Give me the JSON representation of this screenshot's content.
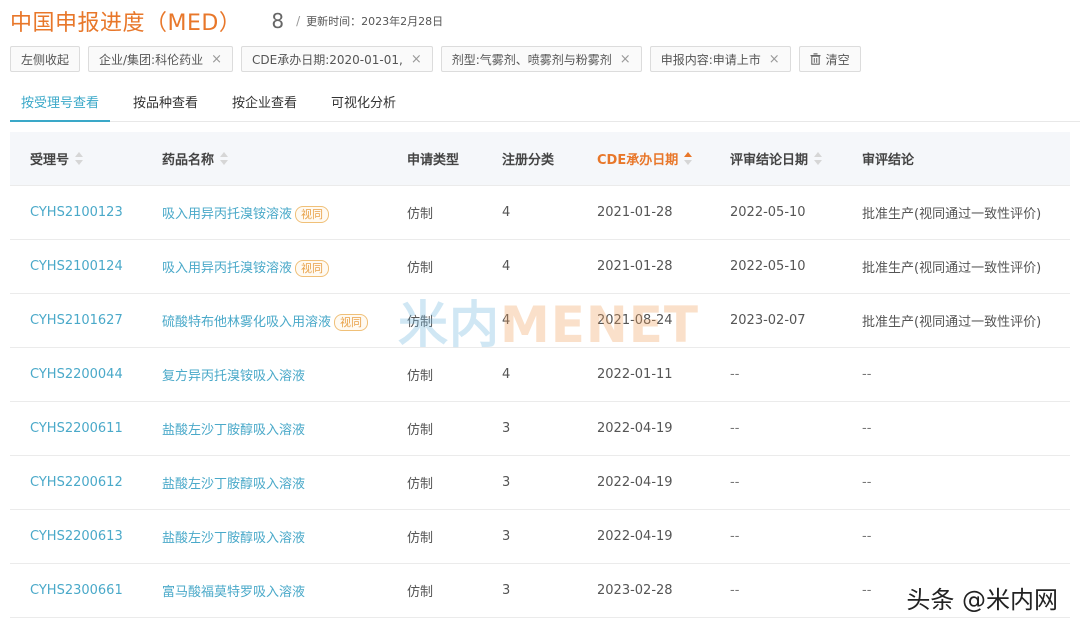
{
  "header": {
    "title": "中国申报进度（MED）",
    "count": "8",
    "separator": "/",
    "update_time": "更新时间：2023年2月28日"
  },
  "filters": [
    {
      "label": "左侧收起",
      "removable": false
    },
    {
      "label": "企业/集团:科伦药业",
      "removable": true
    },
    {
      "label": "CDE承办日期:2020-01-01,",
      "removable": true
    },
    {
      "label": "剂型:气雾剂、喷雾剂与粉雾剂",
      "removable": true
    },
    {
      "label": "申报内容:申请上市",
      "removable": true
    }
  ],
  "clear_label": "清空",
  "tabs": [
    "按受理号查看",
    "按品种查看",
    "按企业查看",
    "可视化分析"
  ],
  "active_tab": 0,
  "columns": [
    "受理号",
    "药品名称",
    "申请类型",
    "注册分类",
    "CDE承办日期",
    "评审结论日期",
    "审评结论"
  ],
  "rows": [
    {
      "id": "CYHS2100123",
      "name": "吸入用异丙托溴铵溶液",
      "tag": "视同",
      "type": "仿制",
      "category": "4",
      "cde_date": "2021-01-28",
      "review_date": "2022-05-10",
      "conclusion": "批准生产(视同通过一致性评价)"
    },
    {
      "id": "CYHS2100124",
      "name": "吸入用异丙托溴铵溶液",
      "tag": "视同",
      "type": "仿制",
      "category": "4",
      "cde_date": "2021-01-28",
      "review_date": "2022-05-10",
      "conclusion": "批准生产(视同通过一致性评价)"
    },
    {
      "id": "CYHS2101627",
      "name": "硫酸特布他林雾化吸入用溶液",
      "tag": "视同",
      "type": "仿制",
      "category": "4",
      "cde_date": "2021-08-24",
      "review_date": "2023-02-07",
      "conclusion": "批准生产(视同通过一致性评价)"
    },
    {
      "id": "CYHS2200044",
      "name": "复方异丙托溴铵吸入溶液",
      "tag": "",
      "type": "仿制",
      "category": "4",
      "cde_date": "2022-01-11",
      "review_date": "--",
      "conclusion": "--"
    },
    {
      "id": "CYHS2200611",
      "name": "盐酸左沙丁胺醇吸入溶液",
      "tag": "",
      "type": "仿制",
      "category": "3",
      "cde_date": "2022-04-19",
      "review_date": "--",
      "conclusion": "--"
    },
    {
      "id": "CYHS2200612",
      "name": "盐酸左沙丁胺醇吸入溶液",
      "tag": "",
      "type": "仿制",
      "category": "3",
      "cde_date": "2022-04-19",
      "review_date": "--",
      "conclusion": "--"
    },
    {
      "id": "CYHS2200613",
      "name": "盐酸左沙丁胺醇吸入溶液",
      "tag": "",
      "type": "仿制",
      "category": "3",
      "cde_date": "2022-04-19",
      "review_date": "--",
      "conclusion": "--"
    },
    {
      "id": "CYHS2300661",
      "name": "富马酸福莫特罗吸入溶液",
      "tag": "",
      "type": "仿制",
      "category": "3",
      "cde_date": "2023-02-28",
      "review_date": "--",
      "conclusion": "--"
    }
  ],
  "watermark": {
    "part1": "米内",
    "part2": "MENET"
  },
  "credit": "头条 @米内网",
  "colors": {
    "accent_orange": "#e8772a",
    "link_blue": "#4aa9c9",
    "tab_blue": "#3aa8c8",
    "tag_orange": "#e8a24a"
  }
}
